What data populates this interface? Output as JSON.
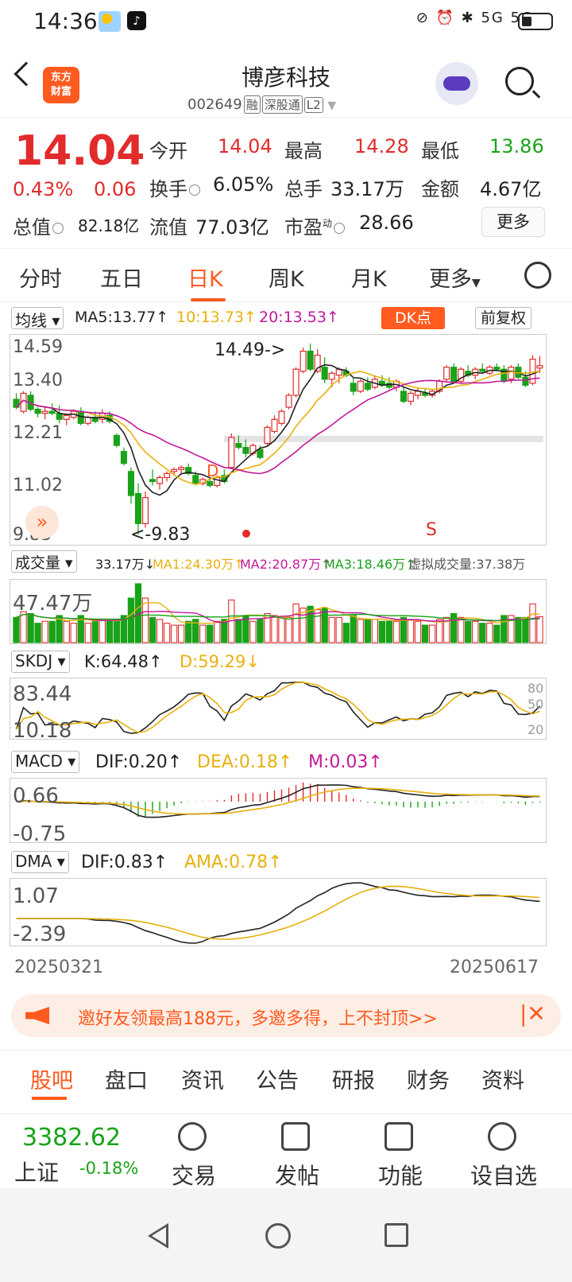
{
  "status_bar": {
    "time": "14:36",
    "icons": "⊘ ⏰ ✱ 5G 5G"
  },
  "header": {
    "logo": "东方\n财富",
    "title": "博彦科技",
    "code": "002649",
    "tags": [
      "融",
      "深股通",
      "L2"
    ]
  },
  "quote": {
    "price": "14.04",
    "change_pct": "0.43%",
    "change": "0.06",
    "open_label": "今开",
    "open": "14.04",
    "high_label": "最高",
    "high": "14.28",
    "low_label": "最低",
    "low": "13.86",
    "turnover_label": "换手",
    "turnover": "6.05%",
    "volume_label": "总手",
    "volume": "33.17万",
    "amount_label": "金额",
    "amount": "4.67亿",
    "mktcap_label": "总值",
    "mktcap": "82.18亿",
    "float_label": "流值",
    "float": "77.03亿",
    "pe_label": "市盈",
    "pe_sup": "动",
    "pe": "28.66",
    "more": "更多"
  },
  "tabs": [
    "分时",
    "五日",
    "日K",
    "周K",
    "月K",
    "更多"
  ],
  "active_tab": "日K",
  "ma_bar": {
    "select": "均线",
    "ma5": "MA5:13.77↑",
    "ma10": "10:13.73↑",
    "ma20": "20:13.53↑",
    "dk": "DK点",
    "fq": "前复权"
  },
  "kline_axis": [
    "14.59",
    "13.40",
    "12.21",
    "11.02",
    "9.83"
  ],
  "kline_annotations": {
    "high": "14.49->",
    "low": "<-9.83",
    "d": "D",
    "s": "S"
  },
  "vol_bar": {
    "select": "成交量",
    "v": "33.17万↓",
    "ma1": "MA1:24.30万↑",
    "ma2": "MA2:20.87万↑",
    "ma3": "MA3:18.46万↑",
    "virtual": "虚拟成交量:37.38万",
    "axis": "47.47万"
  },
  "skdj_bar": {
    "select": "SKDJ",
    "k": "K:64.48↑",
    "d": "D:59.29↓",
    "axis_top": "83.44",
    "axis_bot": "10.18",
    "r80": "80",
    "r50": "50",
    "r20": "20"
  },
  "macd_bar": {
    "select": "MACD",
    "dif": "DIF:0.20↑",
    "dea": "DEA:0.18↑",
    "m": "M:0.03↑",
    "axis_top": "0.66",
    "axis_bot": "-0.75"
  },
  "dma_bar": {
    "select": "DMA",
    "dif": "DIF:0.83↑",
    "ama": "AMA:0.78↑",
    "axis_top": "1.07",
    "axis_bot": "-2.39"
  },
  "dates": {
    "start": "20250321",
    "end": "20250617"
  },
  "banner": {
    "text": "邀好友领最高188元，多邀多得，上不封顶>>"
  },
  "subtabs": [
    "股吧",
    "盘口",
    "资讯",
    "公告",
    "研报",
    "财务",
    "资料"
  ],
  "bottom": {
    "index_value": "3382.62",
    "index_name": "上证",
    "index_change": "-0.18%",
    "nav": [
      "交易",
      "发帖",
      "功能",
      "设自选"
    ]
  },
  "colors": {
    "up": "#e22b2b",
    "down": "#18a318",
    "accent": "#ff5a1f",
    "ma5": "#222222",
    "ma10": "#e8b00d",
    "ma20": "#c2189c"
  },
  "chart_data": {
    "type": "candlestick",
    "candles_ohlc": [
      [
        13.2,
        13.35,
        12.95,
        13.0
      ],
      [
        12.9,
        13.4,
        12.85,
        13.35
      ],
      [
        13.3,
        13.4,
        12.9,
        12.95
      ],
      [
        12.95,
        13.0,
        12.75,
        12.85
      ],
      [
        12.85,
        13.0,
        12.7,
        12.9
      ],
      [
        12.9,
        13.1,
        12.8,
        12.85
      ],
      [
        12.85,
        13.05,
        12.6,
        12.7
      ],
      [
        12.7,
        12.85,
        12.55,
        12.8
      ],
      [
        12.75,
        12.95,
        12.7,
        12.9
      ],
      [
        12.9,
        13.0,
        12.55,
        12.6
      ],
      [
        12.6,
        12.8,
        12.55,
        12.75
      ],
      [
        12.75,
        12.9,
        12.6,
        12.65
      ],
      [
        12.7,
        12.95,
        12.6,
        12.85
      ],
      [
        12.8,
        12.9,
        12.6,
        12.65
      ],
      [
        12.3,
        12.35,
        12.0,
        12.05
      ],
      [
        11.9,
        12.0,
        11.55,
        11.6
      ],
      [
        11.4,
        11.5,
        10.6,
        10.8
      ],
      [
        10.85,
        11.1,
        9.83,
        10.1
      ],
      [
        10.1,
        10.9,
        10.0,
        10.75
      ],
      [
        11.2,
        11.45,
        11.05,
        11.15
      ],
      [
        11.1,
        11.3,
        10.95,
        11.25
      ],
      [
        11.25,
        11.4,
        11.15,
        11.35
      ],
      [
        11.4,
        11.5,
        11.3,
        11.45
      ],
      [
        11.45,
        11.55,
        11.35,
        11.5
      ],
      [
        11.5,
        11.6,
        11.3,
        11.35
      ],
      [
        11.3,
        11.4,
        11.05,
        11.1
      ],
      [
        11.1,
        11.25,
        11.05,
        11.2
      ],
      [
        11.15,
        11.2,
        11.0,
        11.05
      ],
      [
        11.05,
        11.3,
        11.0,
        11.25
      ],
      [
        11.3,
        11.45,
        11.1,
        11.15
      ],
      [
        11.5,
        12.35,
        11.5,
        12.25
      ],
      [
        12.1,
        12.3,
        11.95,
        12.0
      ],
      [
        12.0,
        12.2,
        11.75,
        11.85
      ],
      [
        11.85,
        12.1,
        11.8,
        12.05
      ],
      [
        11.95,
        12.05,
        11.7,
        11.75
      ],
      [
        12.1,
        12.55,
        12.05,
        12.5
      ],
      [
        12.4,
        12.8,
        12.35,
        12.7
      ],
      [
        12.6,
        12.95,
        12.55,
        12.9
      ],
      [
        13.0,
        13.35,
        12.95,
        13.3
      ],
      [
        13.3,
        14.0,
        13.25,
        13.95
      ],
      [
        13.9,
        14.49,
        13.85,
        14.4
      ],
      [
        14.4,
        14.59,
        13.9,
        13.95
      ],
      [
        13.9,
        14.45,
        13.85,
        14.3
      ],
      [
        14.0,
        14.25,
        13.6,
        13.7
      ],
      [
        13.7,
        13.9,
        13.5,
        13.85
      ],
      [
        13.8,
        14.0,
        13.6,
        13.95
      ],
      [
        13.9,
        14.0,
        13.75,
        13.8
      ],
      [
        13.6,
        13.75,
        13.3,
        13.4
      ],
      [
        13.4,
        13.7,
        13.35,
        13.65
      ],
      [
        13.6,
        13.75,
        13.4,
        13.45
      ],
      [
        13.5,
        13.8,
        13.45,
        13.7
      ],
      [
        13.65,
        13.8,
        13.5,
        13.55
      ],
      [
        13.6,
        13.75,
        13.45,
        13.5
      ],
      [
        13.5,
        13.7,
        13.4,
        13.65
      ],
      [
        13.4,
        13.5,
        13.1,
        13.15
      ],
      [
        13.15,
        13.4,
        13.05,
        13.35
      ],
      [
        13.3,
        13.5,
        13.2,
        13.4
      ],
      [
        13.35,
        13.45,
        13.25,
        13.3
      ],
      [
        13.3,
        13.45,
        13.25,
        13.4
      ],
      [
        13.4,
        13.7,
        13.35,
        13.65
      ],
      [
        13.7,
        14.05,
        13.65,
        14.0
      ],
      [
        14.0,
        14.1,
        13.6,
        13.65
      ],
      [
        13.65,
        14.0,
        13.6,
        13.95
      ],
      [
        13.9,
        14.05,
        13.75,
        13.8
      ],
      [
        13.8,
        14.0,
        13.7,
        13.95
      ],
      [
        13.95,
        14.1,
        13.85,
        13.9
      ],
      [
        13.85,
        14.05,
        13.8,
        14.0
      ],
      [
        14.0,
        14.1,
        13.9,
        13.95
      ],
      [
        13.95,
        14.05,
        13.6,
        13.65
      ],
      [
        13.7,
        14.05,
        13.6,
        14.0
      ],
      [
        14.0,
        14.1,
        13.7,
        13.75
      ],
      [
        13.75,
        13.9,
        13.5,
        13.55
      ],
      [
        13.6,
        14.3,
        13.55,
        14.2
      ],
      [
        13.98,
        14.28,
        13.86,
        14.04
      ]
    ],
    "ylim": [
      9.83,
      14.59
    ],
    "x_start": "20250321",
    "x_end": "20250617"
  }
}
